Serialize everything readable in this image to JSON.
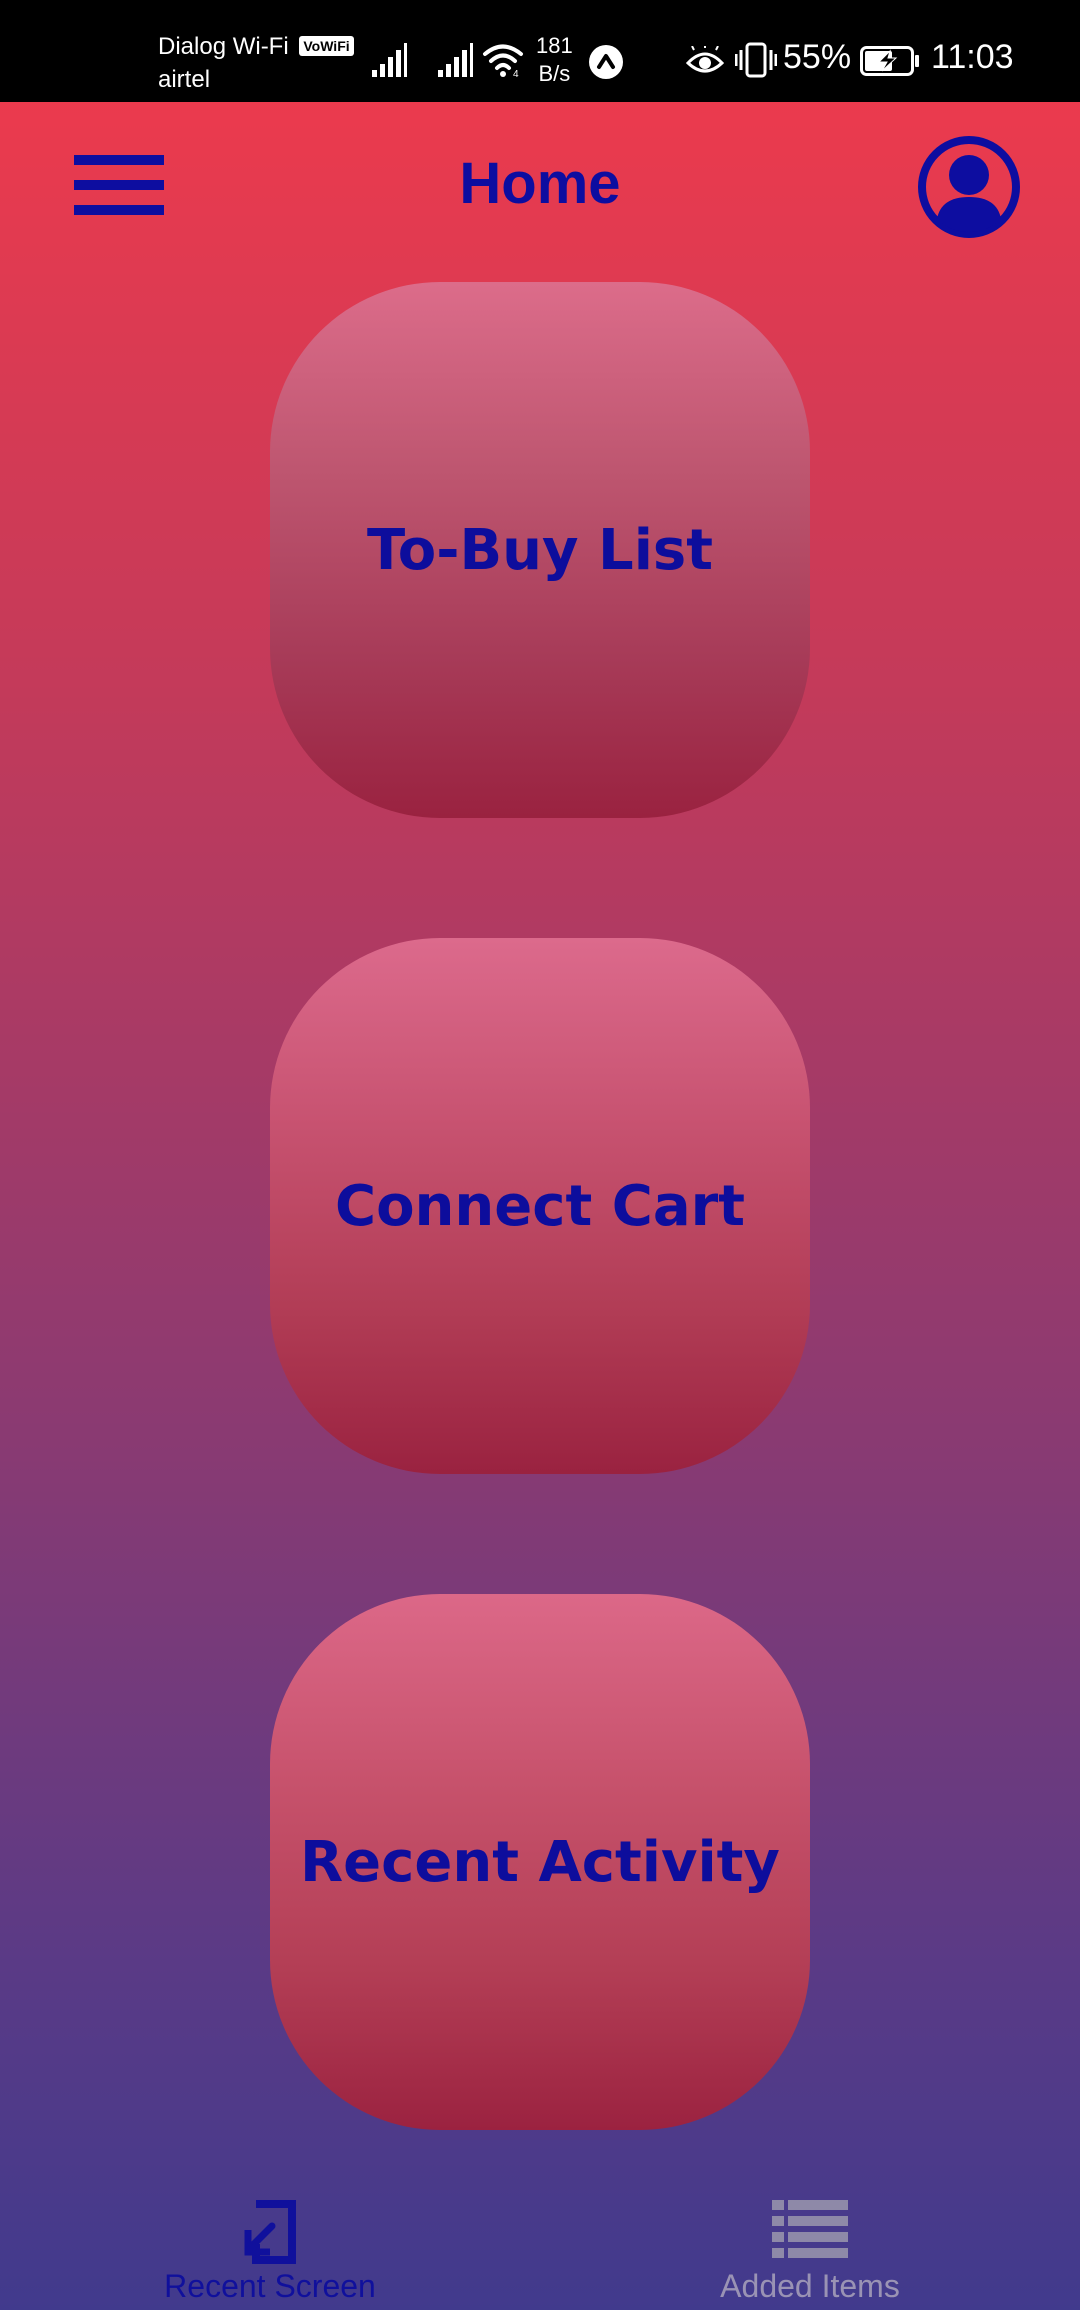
{
  "status_bar": {
    "carrier_primary": "Dialog Wi-Fi",
    "vowifi_badge": "VoWiFi",
    "carrier_secondary": "airtel",
    "net_speed_value": "181",
    "net_speed_unit": "B/s",
    "battery_percent": "55%",
    "time": "11:03",
    "icons": [
      "signal-icon",
      "signal-icon",
      "wifi-icon",
      "app-notification-icon",
      "eye-comfort-icon",
      "vibrate-icon",
      "battery-charging-icon"
    ]
  },
  "header": {
    "title": "Home",
    "menu_icon": "hamburger-menu-icon",
    "profile_icon": "account-circle-icon"
  },
  "tiles": [
    {
      "label": "To-Buy List"
    },
    {
      "label": "Connect Cart"
    },
    {
      "label": "Recent Activity"
    }
  ],
  "bottom_nav": {
    "items": [
      {
        "label": "Recent Screen",
        "icon": "open-in-new-icon",
        "active": true
      },
      {
        "label": "Added Items",
        "icon": "list-icon",
        "active": false
      }
    ]
  },
  "colors": {
    "accent": "#0d0da0",
    "inactive": "#9a93b4",
    "background_top": "#f23a4b",
    "background_bottom": "#413a8d"
  }
}
